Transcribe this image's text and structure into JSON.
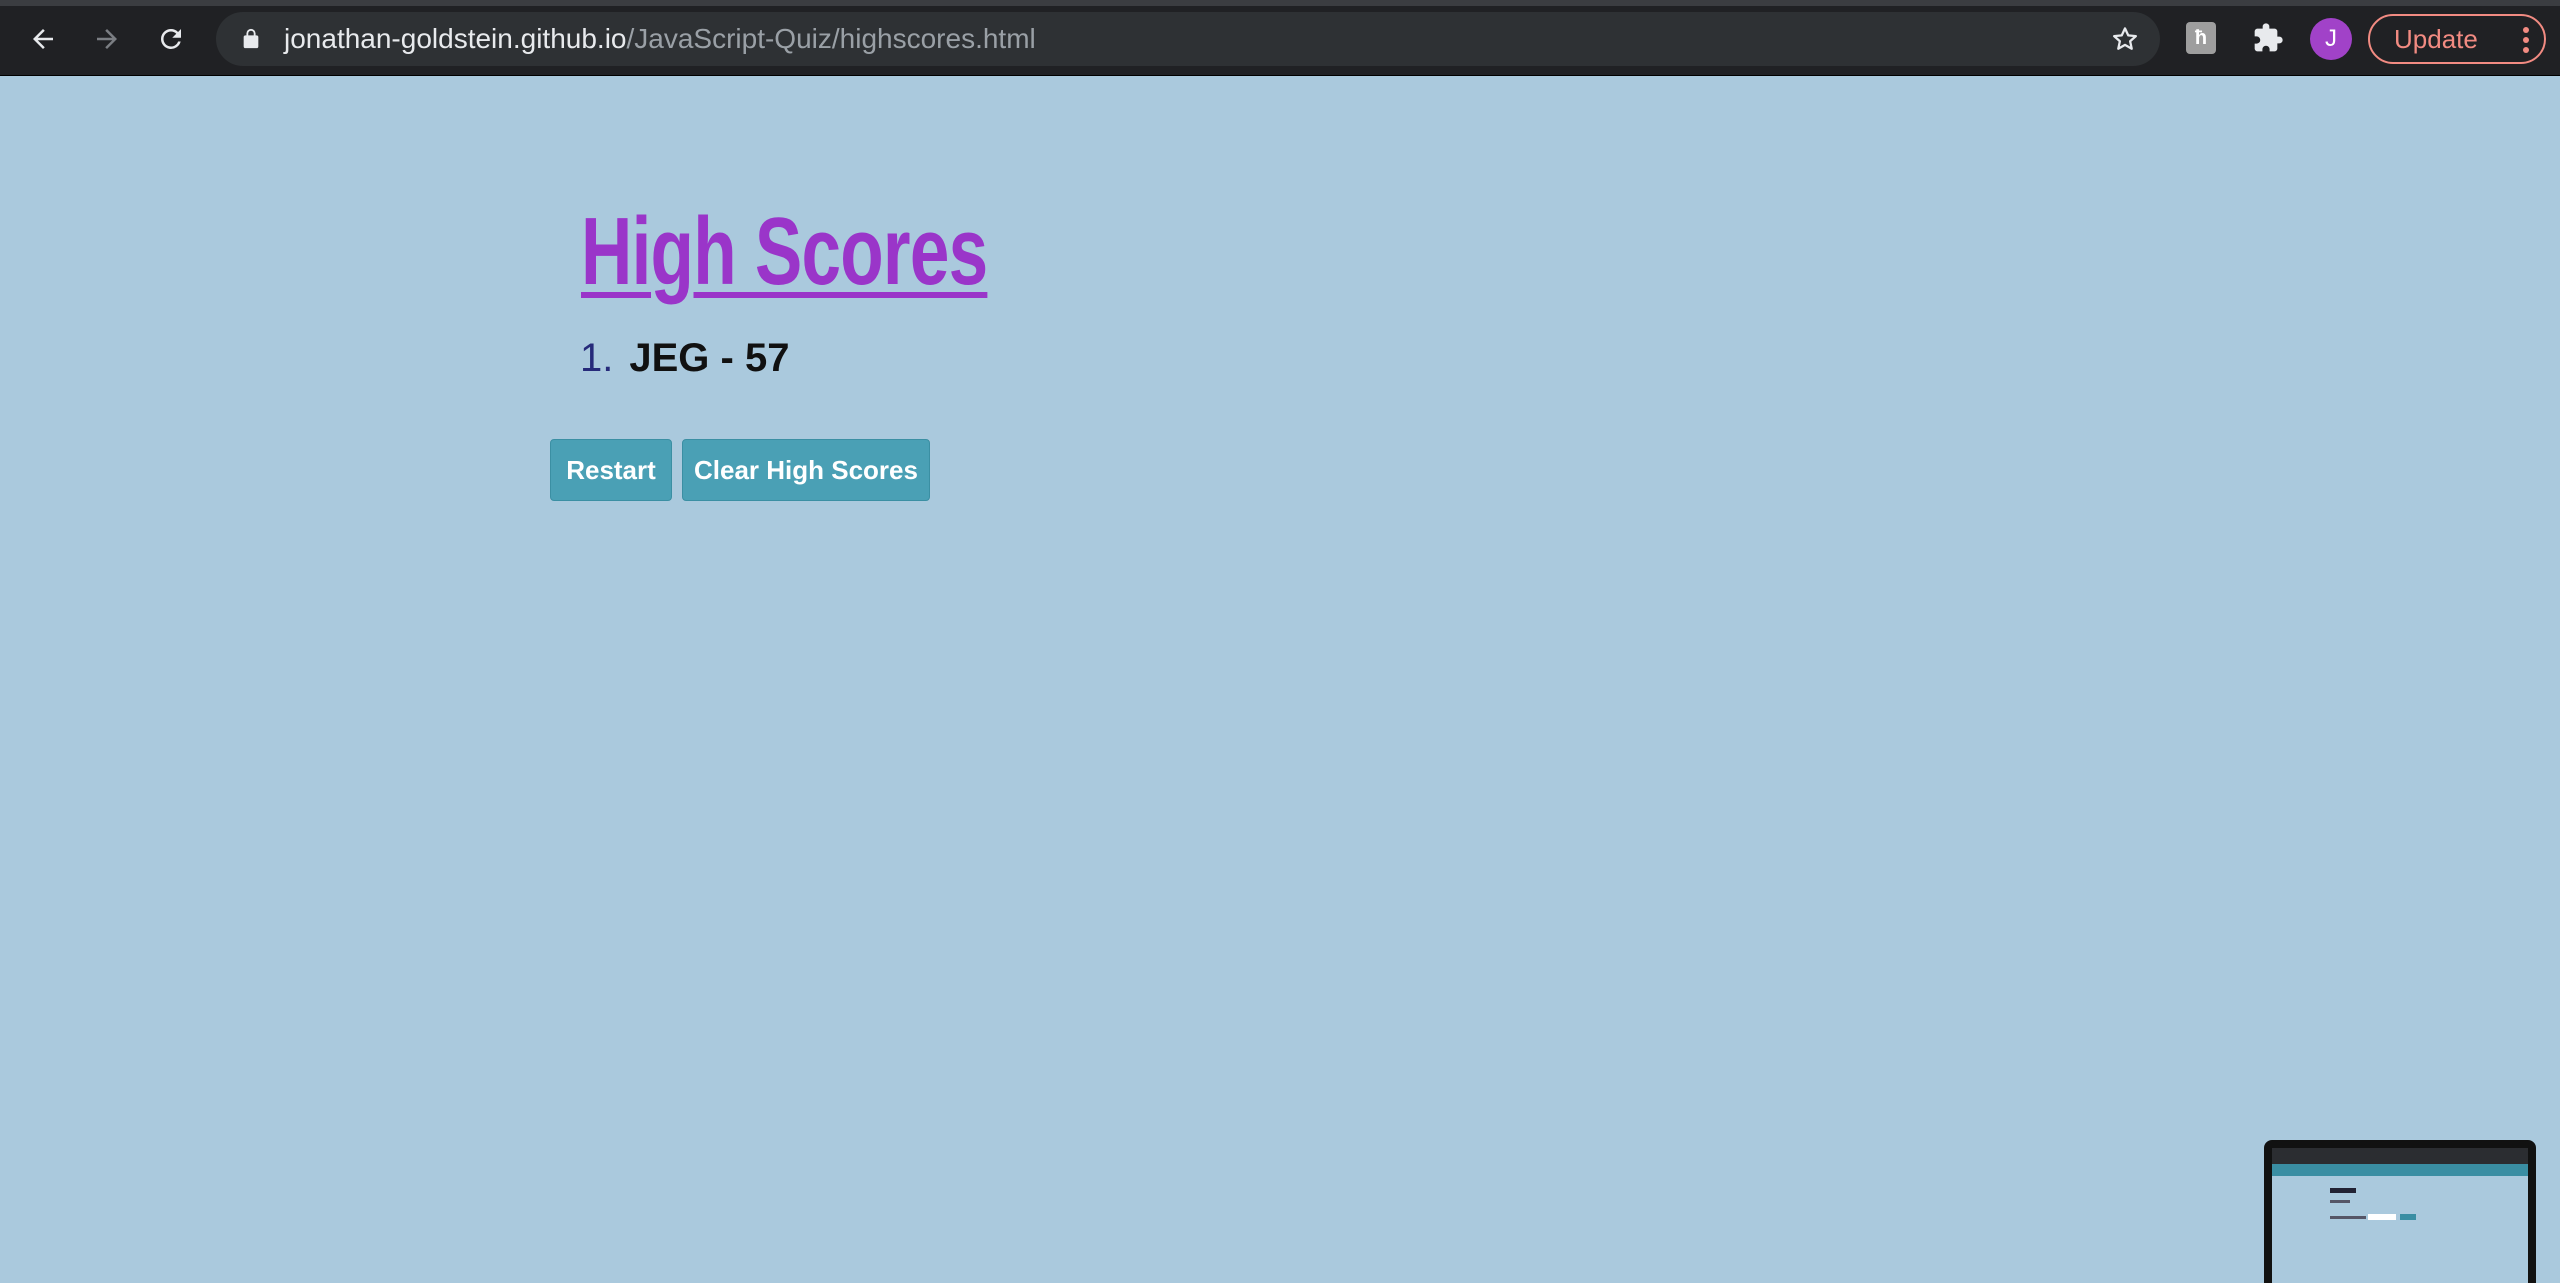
{
  "browser": {
    "url_host": "jonathan-goldstein.github.io",
    "url_path": "/JavaScript-Quiz/highscores.html",
    "profile_initial": "J",
    "update_label": "Update",
    "extension_letter": "ћ"
  },
  "page": {
    "title": "High Scores",
    "scores": [
      {
        "rank": "1.",
        "entry": "JEG - 57"
      }
    ],
    "buttons": {
      "restart": "Restart",
      "clear": "Clear High Scores"
    }
  },
  "colors": {
    "background": "#aac9dd",
    "title": "#9a35c9",
    "button": "#4aa0b5",
    "rank_number": "#262a7a"
  },
  "icons": [
    "back-arrow-icon",
    "forward-arrow-icon",
    "reload-icon",
    "lock-icon",
    "star-icon",
    "puzzle-icon",
    "menu-dots-icon"
  ]
}
